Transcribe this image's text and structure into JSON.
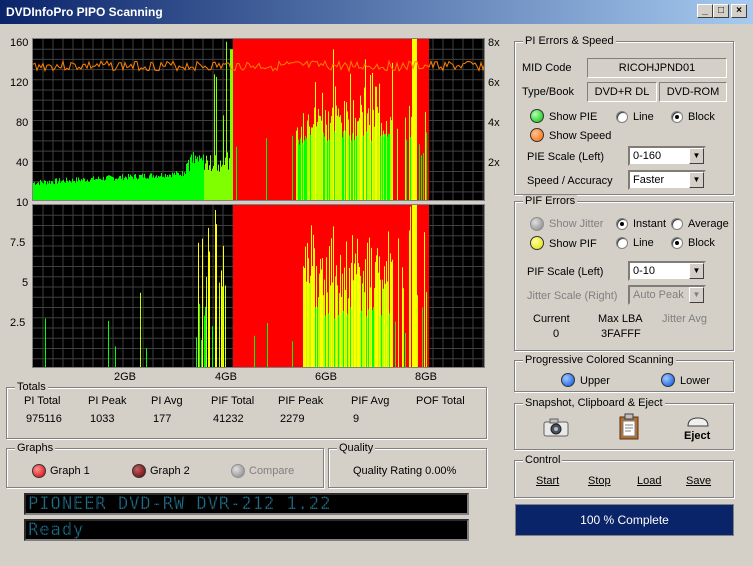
{
  "window": {
    "title": "DVDInfoPro PIPO Scanning",
    "min": "_",
    "max": "□",
    "close": "×"
  },
  "upper_chart": {
    "left_ticks": [
      "160",
      "120",
      "80",
      "40",
      "10"
    ],
    "right_ticks": [
      "8x",
      "6x",
      "4x",
      "2x"
    ]
  },
  "lower_chart": {
    "left_ticks": [
      "10",
      "7.5",
      "5",
      "2.5"
    ]
  },
  "x_ticks": [
    "2GB",
    "4GB",
    "6GB",
    "8GB"
  ],
  "totals": {
    "title": "Totals",
    "headers": [
      "PI Total",
      "PI Peak",
      "PI Avg",
      "PIF Total",
      "PIF Peak",
      "PIF Avg",
      "POF Total"
    ],
    "values": [
      "975116",
      "1033",
      "177",
      "41232",
      "2279",
      "9",
      ""
    ]
  },
  "graphs": {
    "title": "Graphs",
    "graph1": "Graph 1",
    "graph2": "Graph 2",
    "compare": "Compare"
  },
  "quality": {
    "title": "Quality",
    "rating": "Quality Rating 0.00%"
  },
  "lcd": {
    "line1": "PIONEER DVD-RW  DVR-212 1.22",
    "line2": "Ready"
  },
  "pi_panel": {
    "title": "PI Errors & Speed",
    "mid_label": "MID Code",
    "mid_value": "RICOHJPND01",
    "type_label": "Type/Book",
    "type_value": "DVD+R DL",
    "book_value": "DVD-ROM",
    "show_pie": "Show PIE",
    "line": "Line",
    "block": "Block",
    "show_speed": "Show Speed",
    "pie_scale_label": "PIE Scale (Left)",
    "pie_scale_value": "0-160",
    "speed_label": "Speed / Accuracy",
    "speed_value": "Faster"
  },
  "pif_panel": {
    "title": "PIF Errors",
    "show_jitter": "Show Jitter",
    "instant": "Instant",
    "average": "Average",
    "show_pif": "Show PIF",
    "line": "Line",
    "block": "Block",
    "pif_scale_label": "PIF Scale (Left)",
    "pif_scale_value": "0-10",
    "jitter_scale_label": "Jitter Scale (Right)",
    "jitter_scale_value": "Auto Peak",
    "current_label": "Current",
    "current_value": "0",
    "maxlba_label": "Max LBA",
    "maxlba_value": "3FAFFF",
    "jitter_avg_label": "Jitter Avg"
  },
  "progressive": {
    "title": "Progressive Colored Scanning",
    "upper": "Upper",
    "lower": "Lower"
  },
  "snapshot": {
    "title": "Snapshot,  Clipboard  & Eject",
    "eject": "Eject"
  },
  "control": {
    "title": "Control",
    "start": "Start",
    "stop": "Stop",
    "load": "Load",
    "save": "Save"
  },
  "status": {
    "complete": "100 % Complete"
  },
  "colors": {
    "pie": "#00ff00",
    "speed": "#ff8000",
    "bad": "#ff0000",
    "grid": "#404040"
  },
  "chart_data": [
    {
      "type": "area",
      "title": "",
      "y_left": [
        0,
        160
      ],
      "y_right": [
        "0x",
        "8x"
      ],
      "x_range_gb": [
        0,
        9.0
      ],
      "series": [
        {
          "values_note": "",
          "x_gb": [
            0.0,
            0.5,
            1.0,
            1.5,
            2.0,
            2.5,
            3.0,
            3.5,
            3.8,
            4.0,
            4.2,
            6.0,
            6.5,
            7.0,
            7.5,
            8.0,
            9.0
          ],
          "y": [
            15,
            20,
            22,
            22,
            24,
            26,
            28,
            30,
            70,
            90,
            160,
            75,
            110,
            120,
            90,
            160,
            0
          ]
        },
        {
          "name": "",
          "x_gb": [
            0.0,
            2.0,
            4.0,
            6.0,
            8.0
          ],
          "y_speed_x": [
            7.2,
            7.0,
            7.0,
            7.0,
            7.0
          ]
        }
      ]
    },
    {
      "type": "bar",
      "title": "",
      "y_range": [
        0,
        10
      ],
      "x_range_gb": [
        0,
        9.0
      ],
      "values_note": ""
    }
  ]
}
